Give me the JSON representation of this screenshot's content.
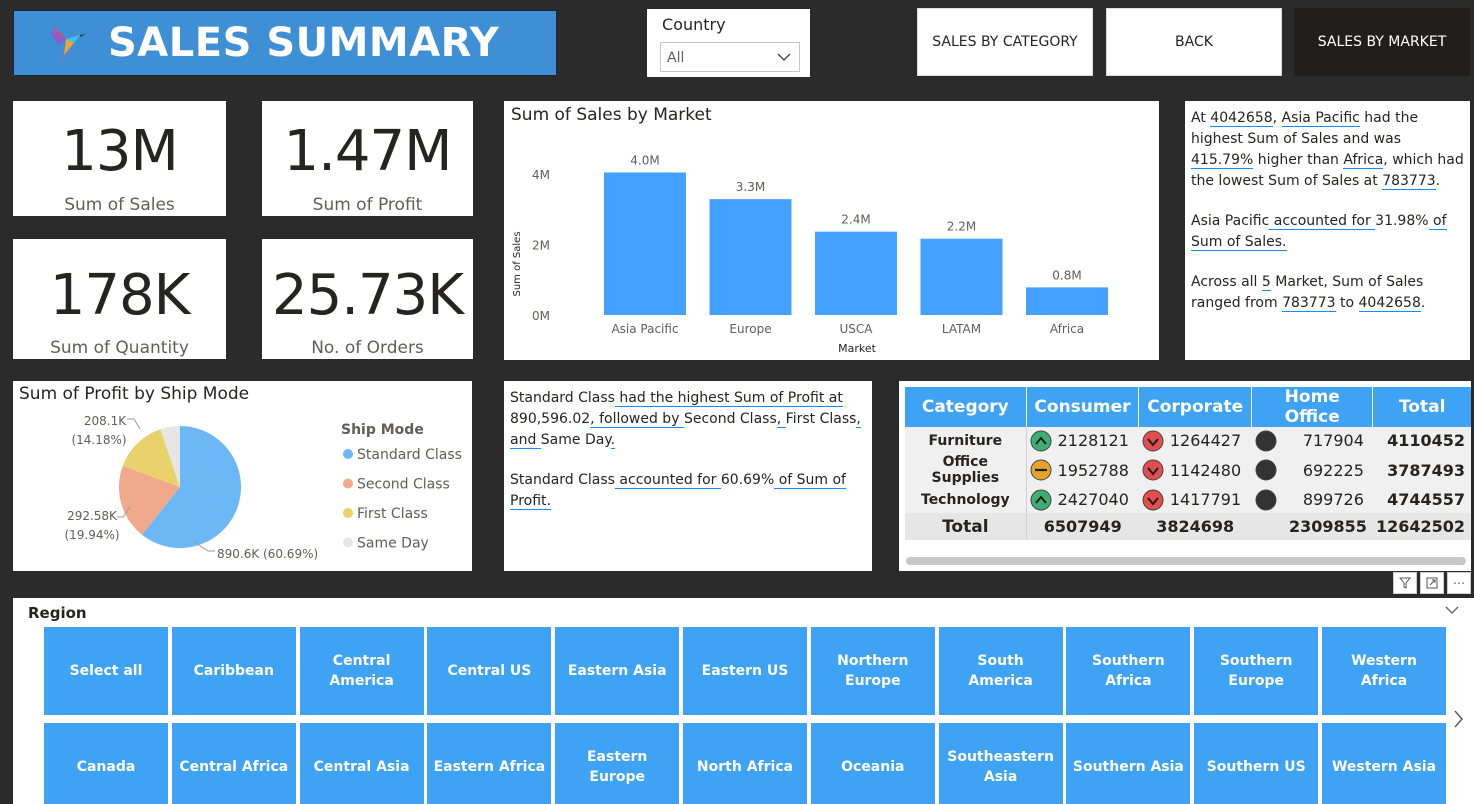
{
  "header": {
    "title": "SALES SUMMARY",
    "logo_icon": "hummingbird-logo-icon"
  },
  "country_slicer": {
    "label": "Country",
    "value": "All"
  },
  "nav": {
    "sales_by_category": "SALES BY CATEGORY",
    "back": "BACK",
    "sales_by_market": "SALES BY MARKET"
  },
  "kpis": {
    "sales": {
      "value": "13M",
      "caption": "Sum of Sales"
    },
    "profit": {
      "value": "1.47M",
      "caption": "Sum of Profit"
    },
    "quantity": {
      "value": "178K",
      "caption": "Sum of Quantity"
    },
    "orders": {
      "value": "25.73K",
      "caption": "No. of Orders"
    }
  },
  "colors": {
    "accent_blue": "#3ea2f5",
    "bar_blue": "#45a1ff",
    "banner_blue": "#3e8fd6",
    "pie_standard": "#6cb8f6",
    "pie_second": "#f0a98c",
    "pie_first": "#e9d16b",
    "pie_same": "#e6e6e6",
    "up_green": "#3fae73",
    "down_red": "#e24d4d",
    "neutral_orange": "#e5a429",
    "neutral_dark": "#333333"
  },
  "chart_data": [
    {
      "type": "bar",
      "title": "Sum of Sales by Market",
      "xlabel": "Market",
      "ylabel": "Sum of Sales",
      "categories": [
        "Asia Pacific",
        "Europe",
        "USCA",
        "LATAM",
        "Africa"
      ],
      "values": [
        4042658,
        3287336,
        2364129,
        2164605,
        783773
      ],
      "data_labels": [
        "4.0M",
        "3.3M",
        "2.4M",
        "2.2M",
        "0.8M"
      ],
      "yticks": [
        "0M",
        "2M",
        "4M"
      ],
      "ylim": [
        0,
        4000000
      ],
      "grid": false
    },
    {
      "type": "pie",
      "title": "Sum of Profit by Ship Mode",
      "legend_title": "Ship Mode",
      "legend_position": "right",
      "categories": [
        "Standard Class",
        "Second Class",
        "First Class",
        "Same Day"
      ],
      "values": [
        890596.02,
        292580,
        208100,
        75924
      ],
      "data_labels": [
        "890.6K (60.69%)",
        "292.58K\n(19.94%)",
        "208.1K\n(14.18%)",
        ""
      ]
    }
  ],
  "market_narrative": {
    "p1": [
      "At ",
      "4042658",
      ", ",
      "Asia Pacific",
      " had the highest Sum of Sales and was ",
      "415.79%",
      " higher than ",
      "Africa",
      ", which had the lowest Sum of Sales at ",
      "783773",
      "."
    ],
    "p2": [
      "Asia Pacific",
      " accounted for ",
      "31.98%",
      " of Sum of Sales."
    ],
    "p3": [
      "Across all ",
      "5",
      " Market, Sum of Sales ranged from ",
      "783773",
      " to ",
      "4042658",
      "."
    ]
  },
  "profit_narrative": {
    "p1": [
      "Standard Class",
      " had the highest Sum of Profit at ",
      "890,596.02",
      ", followed by ",
      "Second Class",
      ", ",
      "First Class",
      ", and ",
      "Same Day",
      "."
    ],
    "p2": [
      "Standard Class",
      " accounted for ",
      "60.69%",
      " of Sum of Profit."
    ]
  },
  "matrix": {
    "headers": [
      "Category",
      "Consumer",
      "Corporate",
      "Home Office",
      "Total"
    ],
    "rows": [
      {
        "category": "Furniture",
        "consumer": "2128121",
        "consumer_ind": "up",
        "corporate": "1264427",
        "corporate_ind": "down",
        "home_office": "717904",
        "home_ind": "neutral-dark",
        "total": "4110452"
      },
      {
        "category": "Office Supplies",
        "consumer": "1952788",
        "consumer_ind": "neutral",
        "corporate": "1142480",
        "corporate_ind": "down",
        "home_office": "692225",
        "home_ind": "neutral-dark",
        "total": "3787493"
      },
      {
        "category": "Technology",
        "consumer": "2427040",
        "consumer_ind": "up",
        "corporate": "1417791",
        "corporate_ind": "down",
        "home_office": "899726",
        "home_ind": "neutral-dark",
        "total": "4744557"
      }
    ],
    "total_row": {
      "label": "Total",
      "consumer": "6507949",
      "corporate": "3824698",
      "home_office": "2309855",
      "total": "12642502"
    }
  },
  "region_slicer": {
    "title": "Region",
    "row1": [
      "Select all",
      "Caribbean",
      "Central America",
      "Central US",
      "Eastern Asia",
      "Eastern US",
      "Northern Europe",
      "South America",
      "Southern Africa",
      "Southern Europe",
      "Western Africa"
    ],
    "row2": [
      "Canada",
      "Central Africa",
      "Central Asia",
      "Eastern Africa",
      "Eastern Europe",
      "North Africa",
      "Oceania",
      "Southeastern Asia",
      "Southern Asia",
      "Southern US",
      "Western Asia"
    ]
  }
}
